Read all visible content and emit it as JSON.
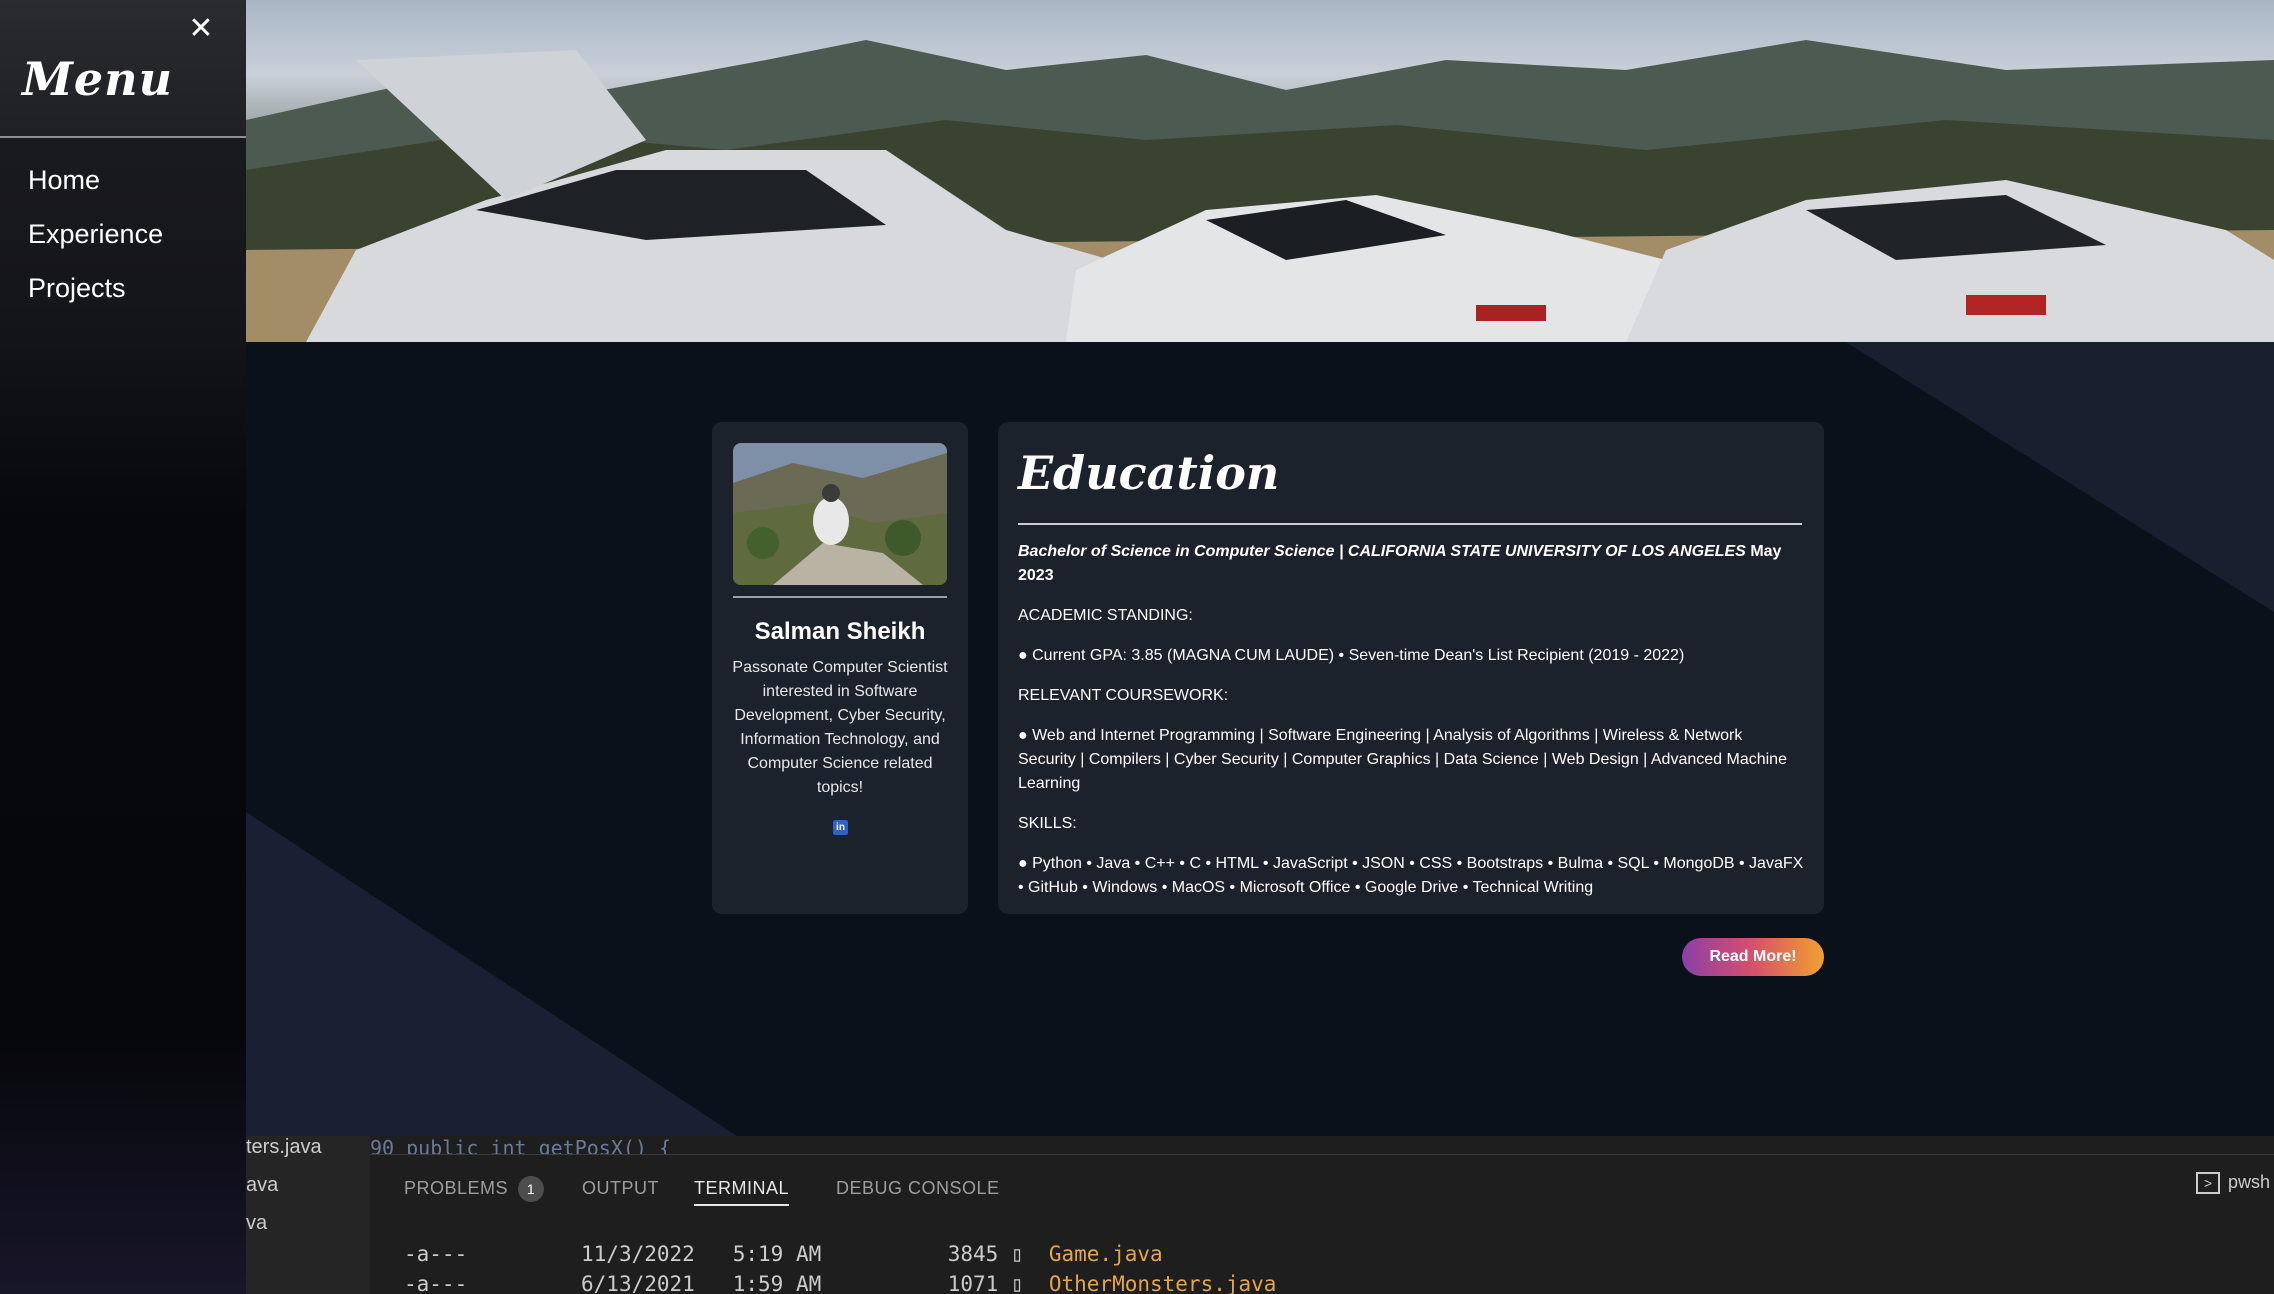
{
  "sidebar": {
    "close_glyph": "✕",
    "title": "Menu",
    "items": [
      {
        "label": "Home"
      },
      {
        "label": "Experience"
      },
      {
        "label": "Projects"
      }
    ]
  },
  "profile": {
    "name": "Salman Sheikh",
    "bio": "Passonate Computer Scientist interested in Software Development, Cyber Security, Information Technology, and Computer Science related topics!",
    "linkedin_glyph": "in",
    "linkedin_color": "#2d64bc"
  },
  "education": {
    "title": "Education",
    "degree": "Bachelor of Science in Computer Science | CALIFORNIA STATE UNIVERSITY OF LOS ANGELES",
    "date": "May 2023",
    "standing_label": "ACADEMIC STANDING:",
    "standing": "● Current GPA: 3.85 (MAGNA CUM LAUDE) • Seven-time Dean's List Recipient (2019 - 2022)",
    "coursework_label": "RELEVANT COURSEWORK:",
    "coursework": "● Web and Internet Programming | Software Engineering | Analysis of Algorithms | Wireless & Network Security | Compilers | Cyber Security | Computer Graphics | Data Science | Web Design | Advanced Machine Learning",
    "skills_label": "SKILLS:",
    "skills": "● Python • Java • C++ • C • HTML • JavaScript • JSON • CSS • Bootstraps • Bulma • SQL • MongoDB • JavaFX • GitHub • Windows • MacOS • Microsoft Office • Google Drive • Technical Writing",
    "read_more": "Read More!"
  },
  "vscode": {
    "explorer_files": [
      "ters.java",
      "ava",
      "va"
    ],
    "code_line": "   90     public int getPosX() {",
    "tabs": {
      "problems": "PROBLEMS",
      "problems_count": "1",
      "output": "OUTPUT",
      "terminal": "TERMINAL",
      "debug": "DEBUG CONSOLE"
    },
    "shell": "pwsh",
    "terminal_rows": [
      {
        "mode": "-a---",
        "date": "11/3/2022",
        "time": "5:19 AM",
        "size": "3845",
        "name": "Game.java"
      },
      {
        "mode": "-a---",
        "date": "6/13/2021",
        "time": "1:59 AM",
        "size": "1071",
        "name": "OtherMonsters.java"
      }
    ]
  }
}
